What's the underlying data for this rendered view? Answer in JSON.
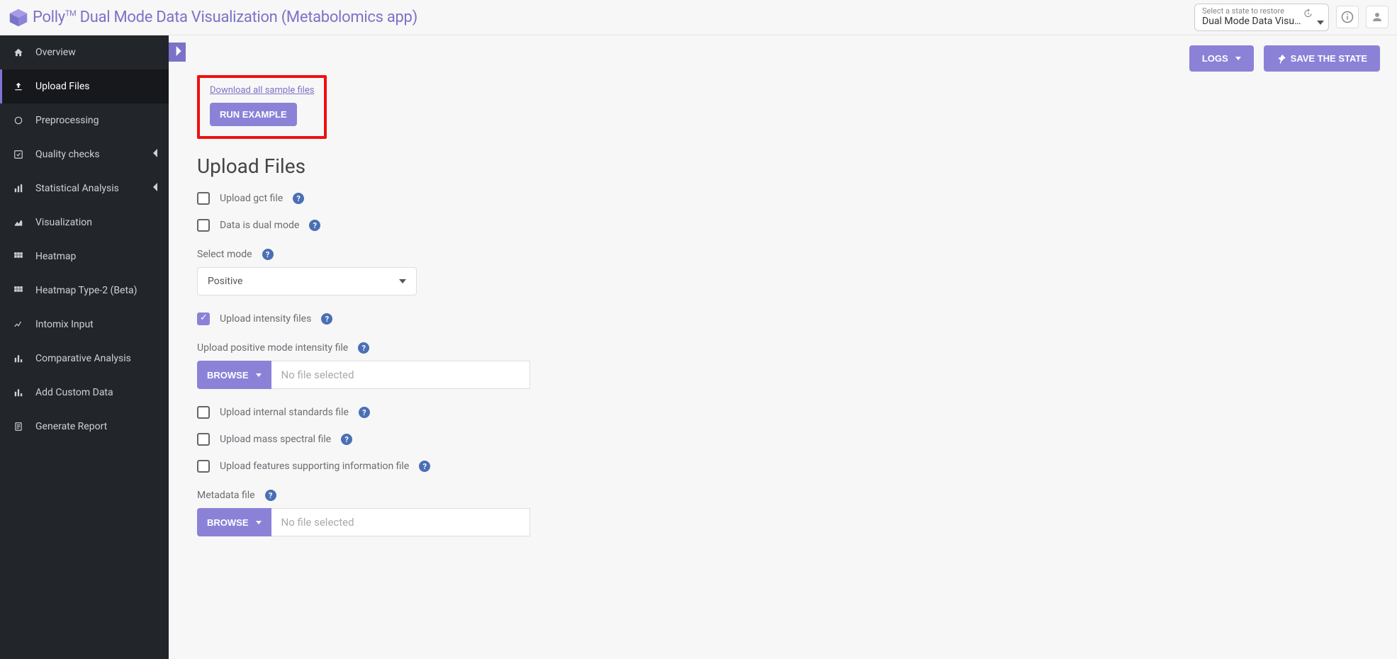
{
  "header": {
    "brand_name": "Polly",
    "brand_tm": "TM",
    "app_title": "Dual Mode Data Visualization (Metabolomics app)",
    "state_tiny": "Select a state to restore",
    "state_main": "Dual Mode Data Visu…"
  },
  "top_actions": {
    "logs": "LOGS",
    "save_state": "SAVE THE STATE"
  },
  "sidebar": {
    "items": [
      {
        "label": "Overview",
        "icon": "home"
      },
      {
        "label": "Upload Files",
        "icon": "upload",
        "active": true
      },
      {
        "label": "Preprocessing",
        "icon": "cycle"
      },
      {
        "label": "Quality checks",
        "icon": "check",
        "chev": true
      },
      {
        "label": "Statistical Analysis",
        "icon": "stats",
        "chev": true
      },
      {
        "label": "Visualization",
        "icon": "area"
      },
      {
        "label": "Heatmap",
        "icon": "grid"
      },
      {
        "label": "Heatmap Type-2 (Beta)",
        "icon": "grid"
      },
      {
        "label": "Intomix Input",
        "icon": "line"
      },
      {
        "label": "Comparative Analysis",
        "icon": "bars"
      },
      {
        "label": "Add Custom Data",
        "icon": "bars"
      },
      {
        "label": "Generate Report",
        "icon": "doc"
      }
    ]
  },
  "actions": {
    "download_samples": "Download all sample files",
    "run_example": "RUN EXAMPLE",
    "browse": "BROWSE",
    "no_file": "No file selected"
  },
  "form": {
    "title": "Upload Files",
    "upload_gct": "Upload gct file",
    "dual_mode": "Data is dual mode",
    "select_mode_label": "Select mode",
    "select_mode_value": "Positive",
    "upload_intensity": "Upload intensity files",
    "upload_pos_intensity": "Upload positive mode intensity file",
    "upload_internal_std": "Upload internal standards file",
    "upload_mass_spectral": "Upload mass spectral file",
    "upload_features": "Upload features supporting information file",
    "metadata_label": "Metadata file"
  }
}
